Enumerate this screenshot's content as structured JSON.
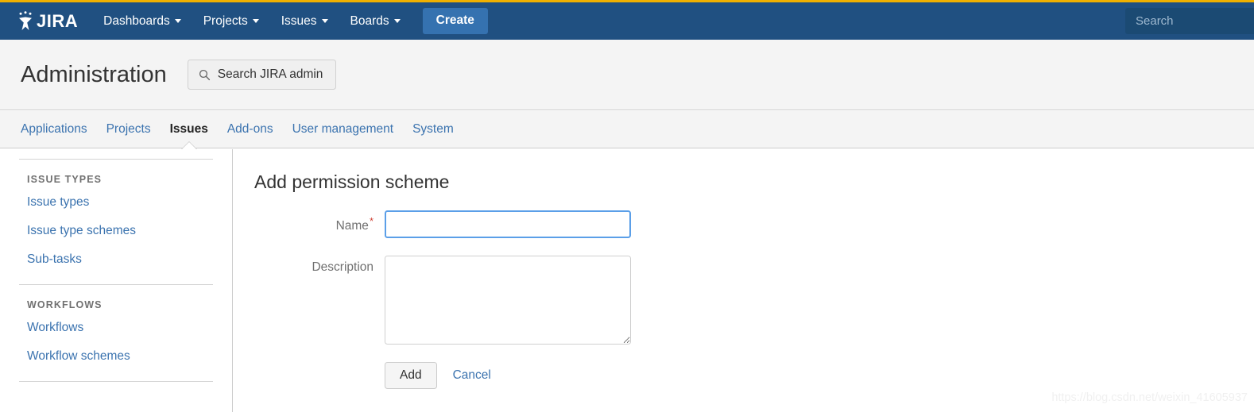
{
  "header": {
    "logo_text": "JIRA",
    "logo_icon": "jira-logo-icon",
    "nav": [
      {
        "label": "Dashboards",
        "has_caret": true
      },
      {
        "label": "Projects",
        "has_caret": true
      },
      {
        "label": "Issues",
        "has_caret": true
      },
      {
        "label": "Boards",
        "has_caret": true
      }
    ],
    "create_label": "Create",
    "search_placeholder": "Search",
    "bar_color": "#205081",
    "accent_rule_color": "#f0b000",
    "create_button_color": "#3572b0"
  },
  "admin": {
    "title": "Administration",
    "search_button_label": "Search JIRA admin",
    "search_button_icon": "search-icon",
    "background_color": "#f4f4f4"
  },
  "tabs": [
    {
      "label": "Applications",
      "active": false
    },
    {
      "label": "Projects",
      "active": false
    },
    {
      "label": "Issues",
      "active": true
    },
    {
      "label": "Add-ons",
      "active": false
    },
    {
      "label": "User management",
      "active": false
    },
    {
      "label": "System",
      "active": false
    }
  ],
  "sidebar": {
    "groups": [
      {
        "heading": "ISSUE TYPES",
        "items": [
          {
            "label": "Issue types"
          },
          {
            "label": "Issue type schemes"
          },
          {
            "label": "Sub-tasks"
          }
        ]
      },
      {
        "heading": "WORKFLOWS",
        "items": [
          {
            "label": "Workflows"
          },
          {
            "label": "Workflow schemes"
          }
        ]
      }
    ],
    "link_color": "#3b73af"
  },
  "form": {
    "title": "Add permission scheme",
    "name_label": "Name",
    "name_required_marker": "*",
    "name_value": "",
    "name_placeholder": "",
    "description_label": "Description",
    "description_value": "",
    "description_placeholder": "",
    "add_label": "Add",
    "cancel_label": "Cancel",
    "focused_border_color": "#5b9fe8",
    "required_marker_color": "#d04437"
  },
  "watermark": {
    "text": "https://blog.csdn.net/weixin_41605937"
  }
}
